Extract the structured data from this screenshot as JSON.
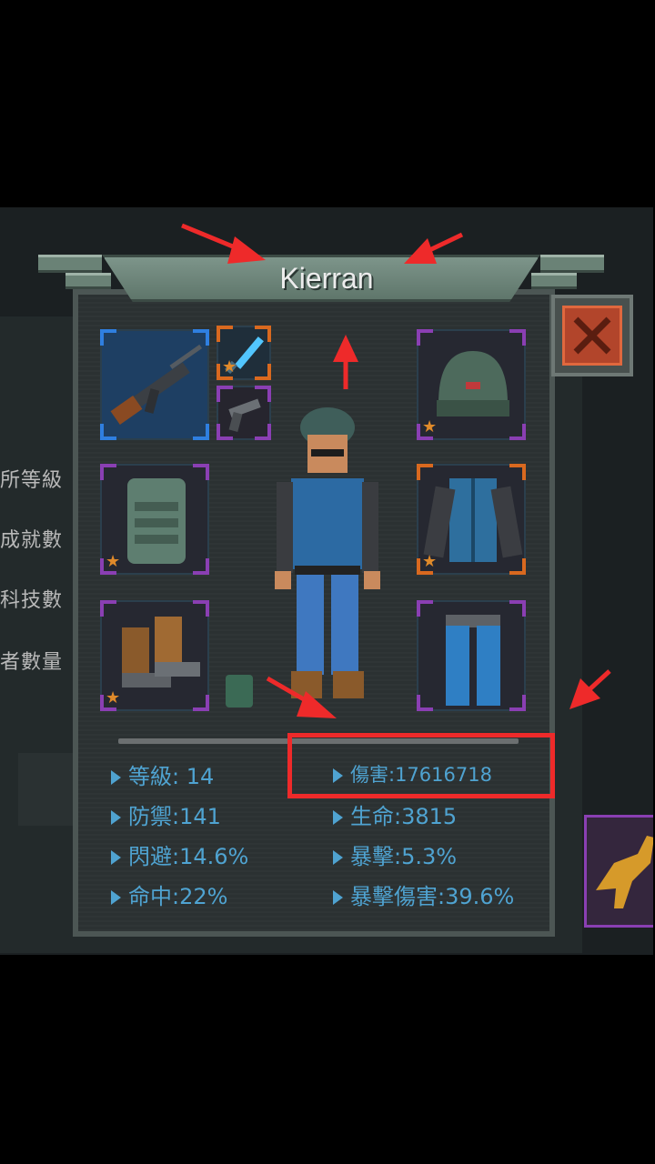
{
  "character": {
    "name": "Kierran"
  },
  "background_menu": [
    "所等級",
    "成就數",
    "科技數",
    "者數量"
  ],
  "stats": {
    "level": "等級: 14",
    "damage": "傷害:17616718",
    "defense": "防禦:141",
    "hp": "生命:3815",
    "dodge": "閃避:14.6%",
    "crit": "暴擊:5.3%",
    "hit": "命中:22%",
    "crit_damage": "暴擊傷害:39.6%"
  },
  "equipment": [
    {
      "slot": "main-weapon",
      "icon": "assault-rifle-icon"
    },
    {
      "slot": "sub-weapon-1",
      "icon": "energy-blade-icon"
    },
    {
      "slot": "sub-weapon-2",
      "icon": "pistol-icon"
    },
    {
      "slot": "helmet",
      "icon": "beanie-icon"
    },
    {
      "slot": "armor",
      "icon": "tactical-vest-icon"
    },
    {
      "slot": "jacket",
      "icon": "jacket-icon"
    },
    {
      "slot": "boots",
      "icon": "boots-icon"
    },
    {
      "slot": "pants",
      "icon": "jeans-icon"
    }
  ],
  "colors": {
    "stat_text": "#4fa3d1",
    "highlight": "#ee2a2a",
    "close_button": "#b2452b"
  }
}
